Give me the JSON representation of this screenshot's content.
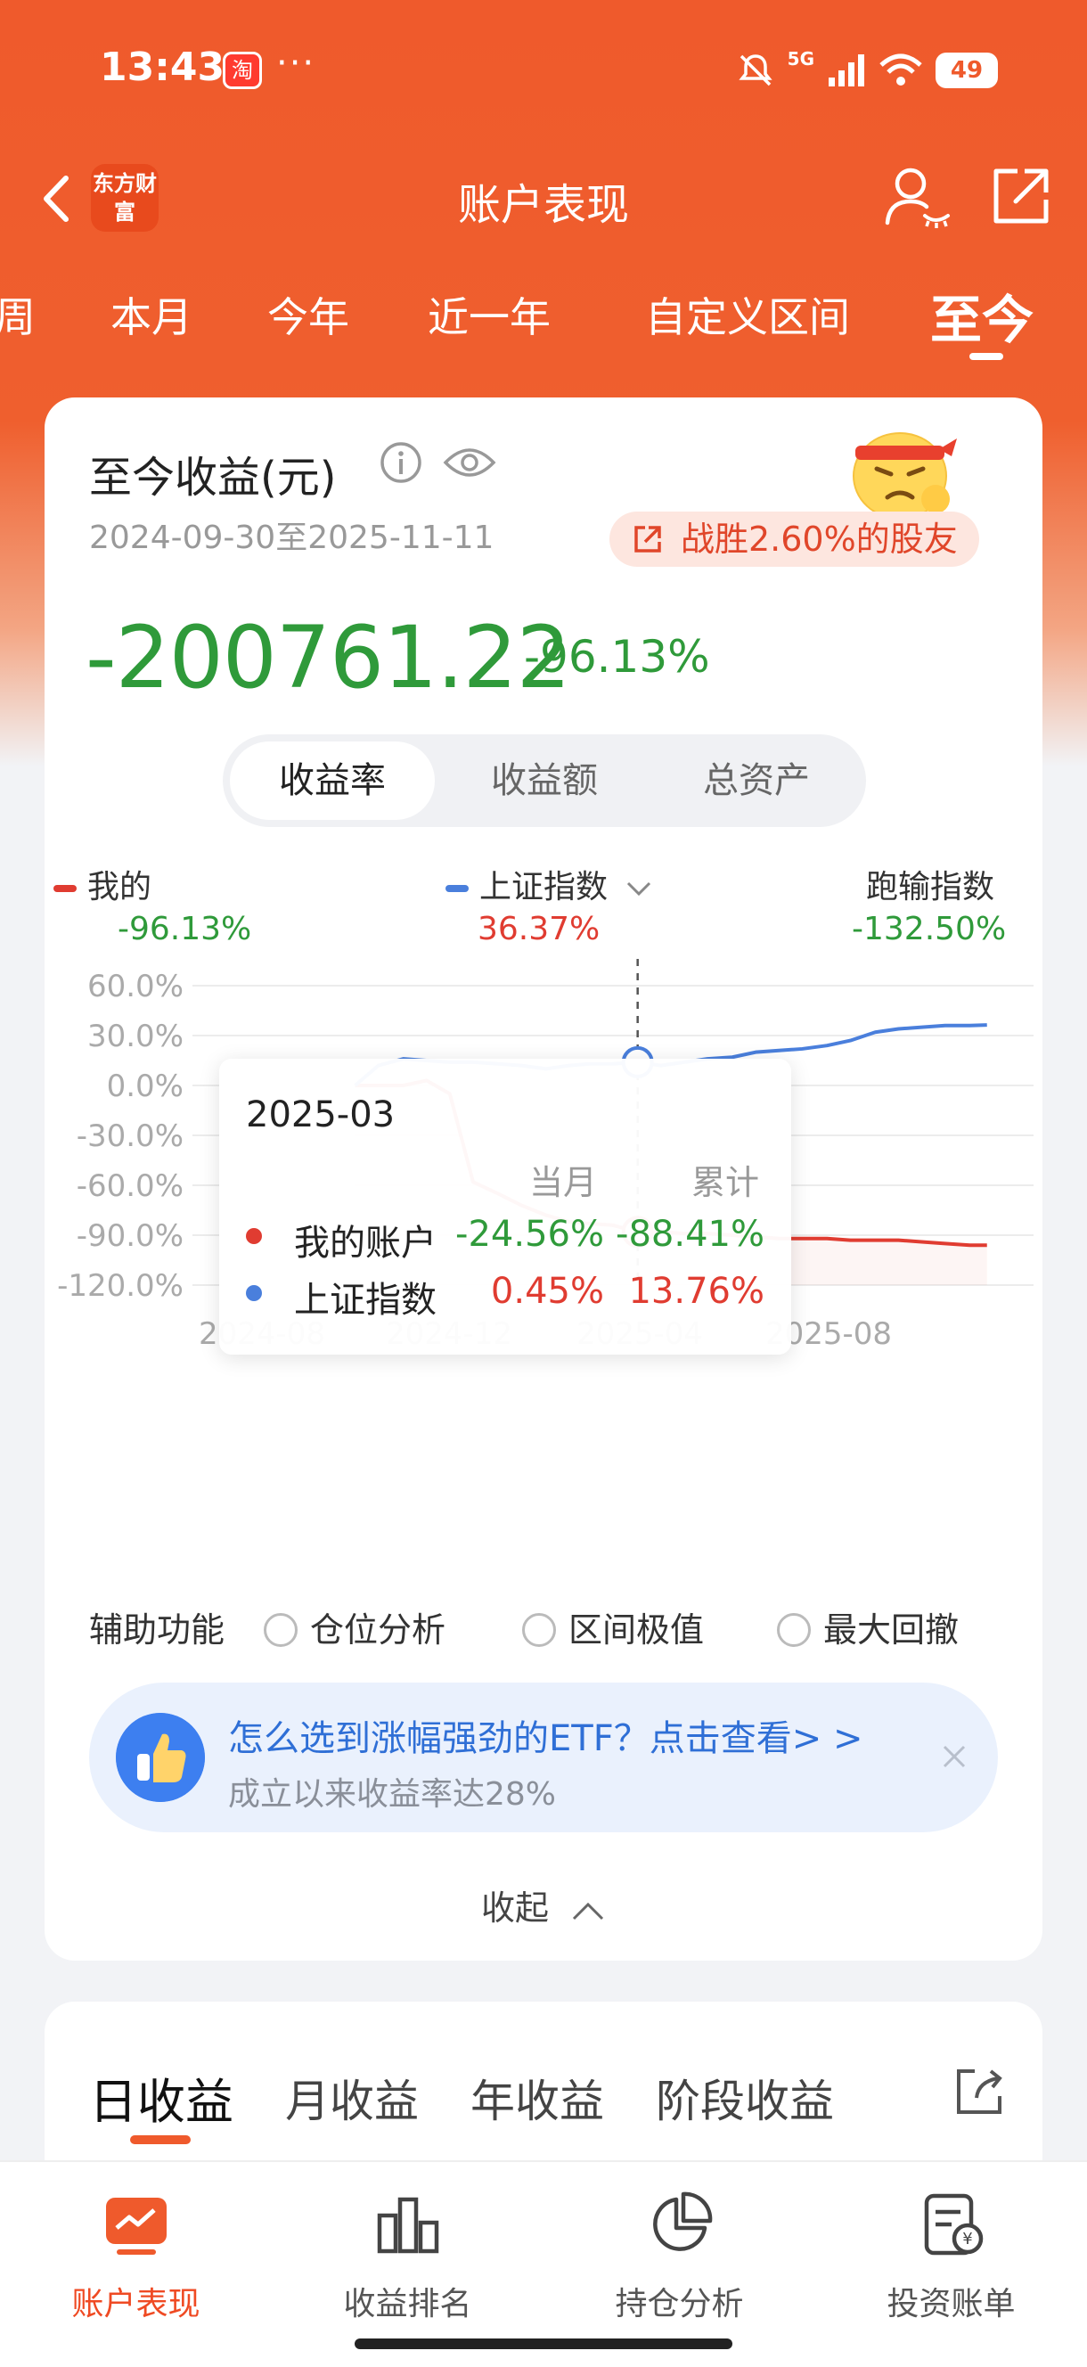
{
  "status_bar": {
    "time": "13:43",
    "app_badge": "淘",
    "more": "···",
    "network": "5G",
    "battery": "49"
  },
  "nav": {
    "brand": "东方财富",
    "title": "账户表现"
  },
  "period_tabs": [
    {
      "label": "周"
    },
    {
      "label": "本月"
    },
    {
      "label": "今年"
    },
    {
      "label": "近一年"
    },
    {
      "label": "自定义区间"
    },
    {
      "label": "至今"
    }
  ],
  "summary": {
    "title": "至今收益(元)",
    "date_range": "2024-09-30至2025-11-11",
    "beat_badge": "战胜2.60%的股友",
    "total_profit": "-200761.22",
    "total_pct": "-96.13%"
  },
  "segment": {
    "options": [
      "收益率",
      "收益额",
      "总资产"
    ],
    "selected": "收益率"
  },
  "legend": {
    "mine": {
      "label": "我的",
      "value": "-96.13%",
      "color": "#e03c31"
    },
    "index": {
      "label": "上证指数",
      "value": "36.37%",
      "color": "#4a7fdc"
    },
    "run": {
      "label": "跑输指数",
      "value": "-132.50%"
    }
  },
  "chart_data": {
    "type": "line",
    "y_ticks": [
      "60.0%",
      "30.0%",
      "0.0%",
      "-30.0%",
      "-60.0%",
      "-90.0%",
      "-120.0%"
    ],
    "x_ticks": [
      "2024-08",
      "2024-12",
      "2025-04",
      "2025-08"
    ],
    "ylim": [
      -120,
      60
    ],
    "x": [
      "2024-09-30",
      "2024-10-15",
      "2024-10-31",
      "2024-11-15",
      "2024-11-30",
      "2024-12-15",
      "2024-12-31",
      "2025-01-15",
      "2025-01-31",
      "2025-02-15",
      "2025-02-28",
      "2025-03-15",
      "2025-03-31",
      "2025-04-15",
      "2025-04-30",
      "2025-05-15",
      "2025-05-31",
      "2025-06-15",
      "2025-06-30",
      "2025-07-15",
      "2025-07-31",
      "2025-08-15",
      "2025-08-31",
      "2025-09-15",
      "2025-09-30",
      "2025-10-15",
      "2025-10-31",
      "2025-11-11"
    ],
    "series": [
      {
        "name": "我的账户",
        "color": "#e03c31",
        "values": [
          0,
          0,
          0,
          3,
          -5,
          -58,
          -65,
          -72,
          -78,
          -82,
          -83,
          -84,
          -88,
          -88,
          -89,
          -89,
          -90,
          -91,
          -92,
          -92,
          -92,
          -93,
          -93,
          -93,
          -94,
          -95,
          -96,
          -96
        ]
      },
      {
        "name": "上证指数",
        "color": "#4a7fdc",
        "values": [
          0,
          12,
          16,
          15,
          14,
          14,
          13,
          12,
          10,
          12,
          13,
          13,
          14,
          12,
          14,
          16,
          17,
          20,
          21,
          22,
          24,
          27,
          32,
          34,
          35,
          36,
          36,
          36.37
        ]
      }
    ],
    "cursor_x": "2025-03-31"
  },
  "tooltip": {
    "date": "2025-03",
    "col_month": "当月",
    "col_total": "累计",
    "rows": [
      {
        "name": "我的账户",
        "month": "-24.56%",
        "total": "-88.41%",
        "color": "#e03c31",
        "month_color": "#2f9a3a",
        "total_color": "#2f9a3a"
      },
      {
        "name": "上证指数",
        "month": "0.45%",
        "total": "13.76%",
        "color": "#4a7fdc",
        "month_color": "#e03c31",
        "total_color": "#e03c31"
      }
    ]
  },
  "aux": {
    "label": "辅助功能",
    "options": [
      "仓位分析",
      "区间极值",
      "最大回撤"
    ]
  },
  "promo": {
    "title": "怎么选到涨幅强劲的ETF？点击查看> >",
    "subtitle": "成立以来收益率达28%"
  },
  "collapse_label": "收起",
  "returns_tabs": [
    "日收益",
    "月收益",
    "年收益",
    "阶段收益"
  ],
  "bottom_nav": [
    {
      "label": "账户表现",
      "icon": "chart-trend-icon"
    },
    {
      "label": "收益排名",
      "icon": "bar-chart-icon"
    },
    {
      "label": "持仓分析",
      "icon": "pie-chart-icon"
    },
    {
      "label": "投资账单",
      "icon": "bill-icon"
    }
  ]
}
